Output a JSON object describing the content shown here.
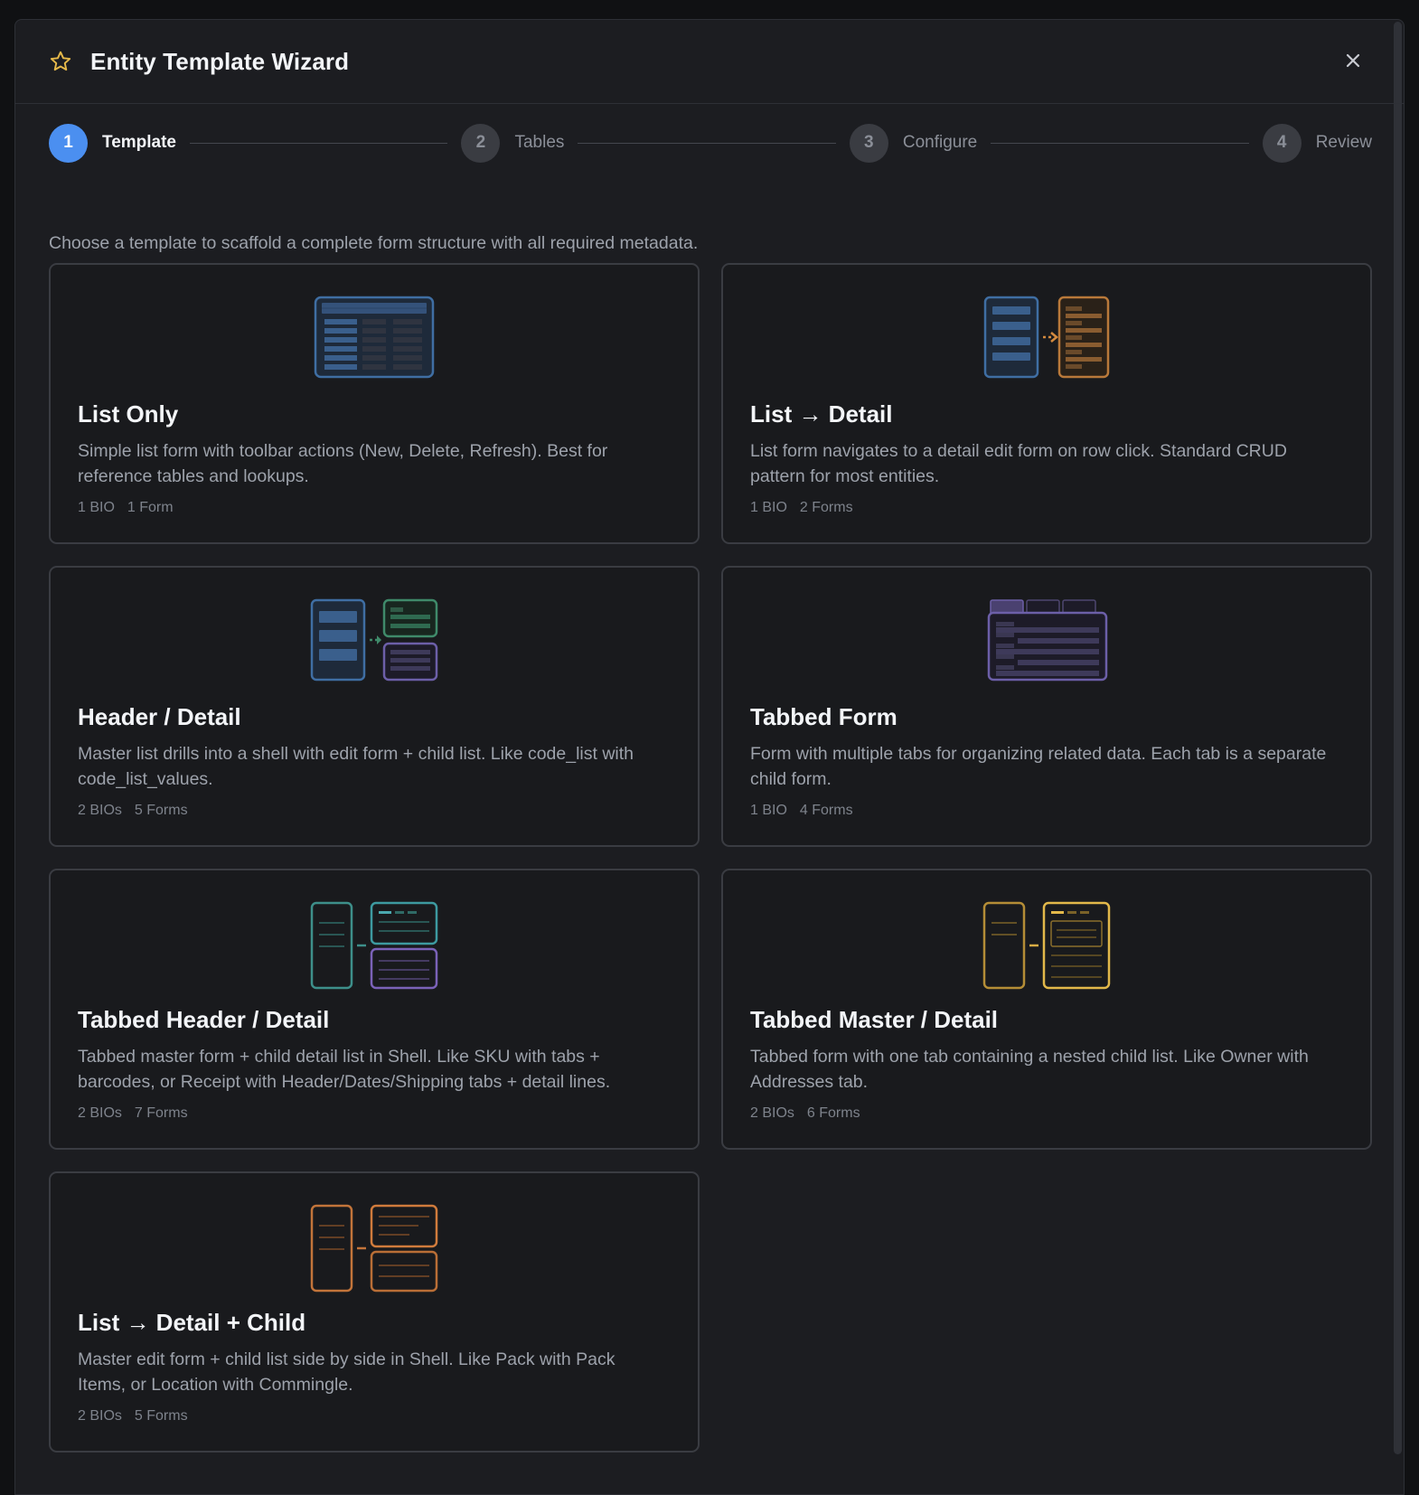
{
  "modal": {
    "title": "Entity Template Wizard",
    "close_label": "×"
  },
  "steps": [
    {
      "number": "1",
      "label": "Template",
      "active": true
    },
    {
      "number": "2",
      "label": "Tables",
      "active": false
    },
    {
      "number": "3",
      "label": "Configure",
      "active": false
    },
    {
      "number": "4",
      "label": "Review",
      "active": false
    }
  ],
  "intro": "Choose a template to scaffold a complete form structure with all required metadata.",
  "templates": [
    {
      "title": "List Only",
      "description": "Simple list form with toolbar actions (New, Delete, Refresh). Best for reference tables and lookups.",
      "bios": "1 BIO",
      "forms": "1 Form",
      "icon": "list-only-icon"
    },
    {
      "title": "List → Detail",
      "description": "List form navigates to a detail edit form on row click. Standard CRUD pattern for most entities.",
      "bios": "1 BIO",
      "forms": "2 Forms",
      "icon": "list-detail-icon"
    },
    {
      "title": "Header / Detail",
      "description": "Master list drills into a shell with edit form + child list. Like code_list with code_list_values.",
      "bios": "2 BIOs",
      "forms": "5 Forms",
      "icon": "header-detail-icon"
    },
    {
      "title": "Tabbed Form",
      "description": "Form with multiple tabs for organizing related data. Each tab is a separate child form.",
      "bios": "1 BIO",
      "forms": "4 Forms",
      "icon": "tabbed-form-icon"
    },
    {
      "title": "Tabbed Header / Detail",
      "description": "Tabbed master form + child detail list in Shell. Like SKU with tabs + barcodes, or Receipt with Header/Dates/Shipping tabs + detail lines.",
      "bios": "2 BIOs",
      "forms": "7 Forms",
      "icon": "tabbed-header-detail-icon"
    },
    {
      "title": "Tabbed Master / Detail",
      "description": "Tabbed form with one tab containing a nested child list. Like Owner with Addresses tab.",
      "bios": "2 BIOs",
      "forms": "6 Forms",
      "icon": "tabbed-master-detail-icon"
    },
    {
      "title": "List → Detail + Child",
      "description": "Master edit form + child list side by side in Shell. Like Pack with Pack Items, or Location with Commingle.",
      "bios": "2 BIOs",
      "forms": "5 Forms",
      "icon": "list-detail-child-icon"
    }
  ],
  "colors": {
    "accent": "#4b8ff0",
    "star": "#e6b94a",
    "blue_icon": "#3f6ea3",
    "orange_icon": "#b9793a",
    "green_icon": "#3f8a6a",
    "purple_icon": "#6c5fa8",
    "teal_icon": "#3d8f8a",
    "gold_icon": "#d9ad45",
    "copper_icon": "#c2743a"
  }
}
